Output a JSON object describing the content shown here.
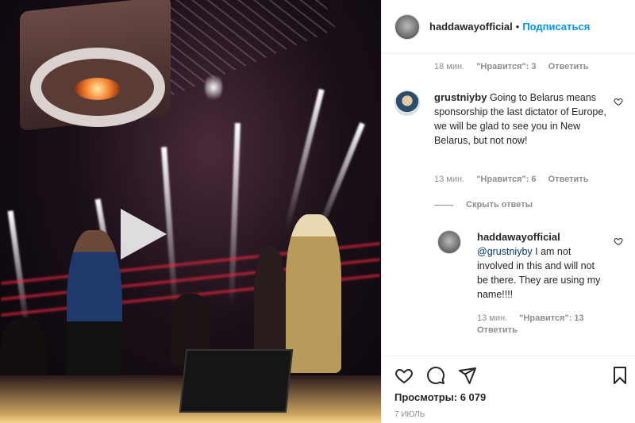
{
  "header": {
    "username": "haddawayofficial",
    "separator": "•",
    "follow_label": "Подписаться"
  },
  "prev_meta": {
    "time": "18 мин.",
    "likes": "\"Нравится\": 3",
    "reply": "Ответить"
  },
  "comment": {
    "username": "grustniyby",
    "text": "Going to Belarus means sponsorship the last dictator of Europe, we will be glad to see you in New Belarus, but not now!",
    "time": "13 мин.",
    "likes": "\"Нравится\": 6",
    "reply": "Ответить"
  },
  "hide_replies": "Скрыть ответы",
  "reply": {
    "username": "haddawayofficial",
    "mention": "@grustniyby",
    "text": " I am not involved in this and will not be there. They are using my name!!!!",
    "time": "13 мин.",
    "likes": "\"Нравится\": 13",
    "reply": "Ответить"
  },
  "footer": {
    "views_label": "Просмотры:",
    "views_count": "6 079",
    "date": "7 июль"
  },
  "icons": [
    "heart-icon",
    "comment-icon",
    "share-icon",
    "bookmark-icon",
    "play-icon"
  ],
  "colors": {
    "link": "#0095f6",
    "muted": "#8e8e8e",
    "text": "#262626"
  }
}
